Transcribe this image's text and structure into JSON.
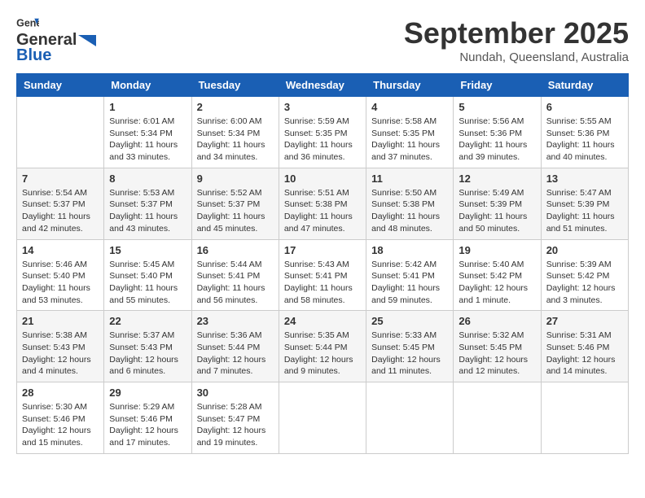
{
  "header": {
    "logo": {
      "line1": "General",
      "line2": "Blue"
    },
    "title": "September 2025",
    "location": "Nundah, Queensland, Australia"
  },
  "weekdays": [
    "Sunday",
    "Monday",
    "Tuesday",
    "Wednesday",
    "Thursday",
    "Friday",
    "Saturday"
  ],
  "weeks": [
    [
      {
        "day": "",
        "info": ""
      },
      {
        "day": "1",
        "info": "Sunrise: 6:01 AM\nSunset: 5:34 PM\nDaylight: 11 hours\nand 33 minutes."
      },
      {
        "day": "2",
        "info": "Sunrise: 6:00 AM\nSunset: 5:34 PM\nDaylight: 11 hours\nand 34 minutes."
      },
      {
        "day": "3",
        "info": "Sunrise: 5:59 AM\nSunset: 5:35 PM\nDaylight: 11 hours\nand 36 minutes."
      },
      {
        "day": "4",
        "info": "Sunrise: 5:58 AM\nSunset: 5:35 PM\nDaylight: 11 hours\nand 37 minutes."
      },
      {
        "day": "5",
        "info": "Sunrise: 5:56 AM\nSunset: 5:36 PM\nDaylight: 11 hours\nand 39 minutes."
      },
      {
        "day": "6",
        "info": "Sunrise: 5:55 AM\nSunset: 5:36 PM\nDaylight: 11 hours\nand 40 minutes."
      }
    ],
    [
      {
        "day": "7",
        "info": "Sunrise: 5:54 AM\nSunset: 5:37 PM\nDaylight: 11 hours\nand 42 minutes."
      },
      {
        "day": "8",
        "info": "Sunrise: 5:53 AM\nSunset: 5:37 PM\nDaylight: 11 hours\nand 43 minutes."
      },
      {
        "day": "9",
        "info": "Sunrise: 5:52 AM\nSunset: 5:37 PM\nDaylight: 11 hours\nand 45 minutes."
      },
      {
        "day": "10",
        "info": "Sunrise: 5:51 AM\nSunset: 5:38 PM\nDaylight: 11 hours\nand 47 minutes."
      },
      {
        "day": "11",
        "info": "Sunrise: 5:50 AM\nSunset: 5:38 PM\nDaylight: 11 hours\nand 48 minutes."
      },
      {
        "day": "12",
        "info": "Sunrise: 5:49 AM\nSunset: 5:39 PM\nDaylight: 11 hours\nand 50 minutes."
      },
      {
        "day": "13",
        "info": "Sunrise: 5:47 AM\nSunset: 5:39 PM\nDaylight: 11 hours\nand 51 minutes."
      }
    ],
    [
      {
        "day": "14",
        "info": "Sunrise: 5:46 AM\nSunset: 5:40 PM\nDaylight: 11 hours\nand 53 minutes."
      },
      {
        "day": "15",
        "info": "Sunrise: 5:45 AM\nSunset: 5:40 PM\nDaylight: 11 hours\nand 55 minutes."
      },
      {
        "day": "16",
        "info": "Sunrise: 5:44 AM\nSunset: 5:41 PM\nDaylight: 11 hours\nand 56 minutes."
      },
      {
        "day": "17",
        "info": "Sunrise: 5:43 AM\nSunset: 5:41 PM\nDaylight: 11 hours\nand 58 minutes."
      },
      {
        "day": "18",
        "info": "Sunrise: 5:42 AM\nSunset: 5:41 PM\nDaylight: 11 hours\nand 59 minutes."
      },
      {
        "day": "19",
        "info": "Sunrise: 5:40 AM\nSunset: 5:42 PM\nDaylight: 12 hours\nand 1 minute."
      },
      {
        "day": "20",
        "info": "Sunrise: 5:39 AM\nSunset: 5:42 PM\nDaylight: 12 hours\nand 3 minutes."
      }
    ],
    [
      {
        "day": "21",
        "info": "Sunrise: 5:38 AM\nSunset: 5:43 PM\nDaylight: 12 hours\nand 4 minutes."
      },
      {
        "day": "22",
        "info": "Sunrise: 5:37 AM\nSunset: 5:43 PM\nDaylight: 12 hours\nand 6 minutes."
      },
      {
        "day": "23",
        "info": "Sunrise: 5:36 AM\nSunset: 5:44 PM\nDaylight: 12 hours\nand 7 minutes."
      },
      {
        "day": "24",
        "info": "Sunrise: 5:35 AM\nSunset: 5:44 PM\nDaylight: 12 hours\nand 9 minutes."
      },
      {
        "day": "25",
        "info": "Sunrise: 5:33 AM\nSunset: 5:45 PM\nDaylight: 12 hours\nand 11 minutes."
      },
      {
        "day": "26",
        "info": "Sunrise: 5:32 AM\nSunset: 5:45 PM\nDaylight: 12 hours\nand 12 minutes."
      },
      {
        "day": "27",
        "info": "Sunrise: 5:31 AM\nSunset: 5:46 PM\nDaylight: 12 hours\nand 14 minutes."
      }
    ],
    [
      {
        "day": "28",
        "info": "Sunrise: 5:30 AM\nSunset: 5:46 PM\nDaylight: 12 hours\nand 15 minutes."
      },
      {
        "day": "29",
        "info": "Sunrise: 5:29 AM\nSunset: 5:46 PM\nDaylight: 12 hours\nand 17 minutes."
      },
      {
        "day": "30",
        "info": "Sunrise: 5:28 AM\nSunset: 5:47 PM\nDaylight: 12 hours\nand 19 minutes."
      },
      {
        "day": "",
        "info": ""
      },
      {
        "day": "",
        "info": ""
      },
      {
        "day": "",
        "info": ""
      },
      {
        "day": "",
        "info": ""
      }
    ]
  ]
}
